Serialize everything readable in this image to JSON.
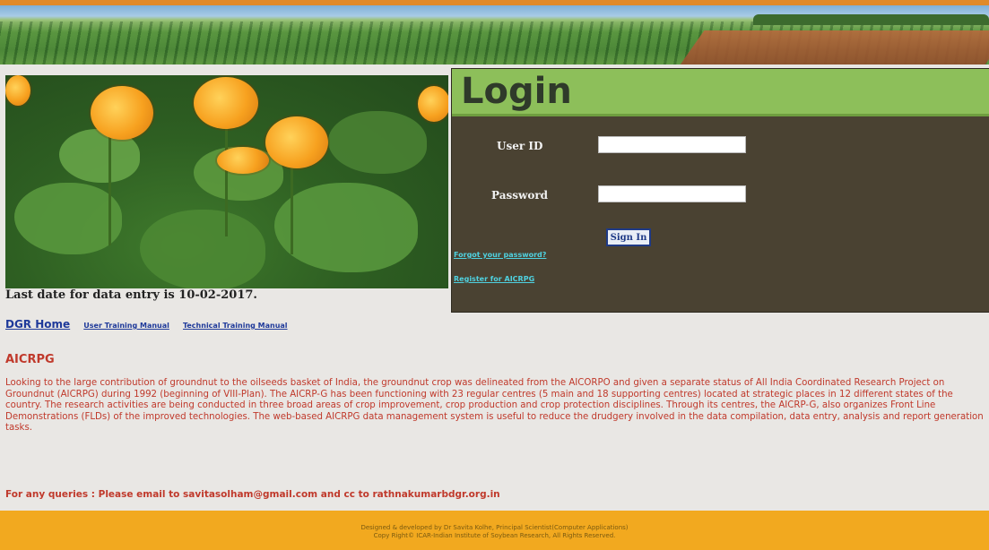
{
  "login": {
    "title": "Login",
    "user_id_label": "User ID",
    "user_id_value": "",
    "password_label": "Password",
    "password_value": "",
    "signin_label": "Sign In",
    "forgot_link": "Forgot your password?",
    "register_link": "Register for AICRPG"
  },
  "notice": {
    "last_date": "Last date for data entry is 10-02-2017."
  },
  "nav": {
    "home": "DGR Home",
    "user_manual": "User Training Manual",
    "technical_manual": "Technical Training Manual"
  },
  "section": {
    "title": "AICRPG",
    "description": "Looking to the large contribution of groundnut to the oilseeds basket of India, the groundnut crop was delineated from the AICORPO and given a separate status of All India Coordinated Research Project on Groundnut (AICRPG) during 1992 (beginning of VIII-Plan). The AICRP-G has been functioning with 23 regular centres (5 main and 18 supporting centres) located at strategic places in 12 different states of the country. The research activities are being conducted in three broad areas of crop improvement, crop production and crop protection disciplines. Through its centres, the AICRP-G, also organizes Front Line Demonstrations (FLDs) of the improved technologies. The web-based AICRPG data management system is useful to reduce the drudgery involved in the data compilation, data entry, analysis and report generation tasks.",
    "contact": "For any queries : Please email to savitasolham@gmail.com and cc to rathnakumarbdgr.org.in"
  },
  "footer": {
    "line1": "Designed & developed by Dr Savita Kolhe, Principal Scientist(Computer Applications)",
    "line2": "Copy Right© ICAR-Indian Institute of Soybean Research, All Rights Reserved."
  },
  "colors": {
    "login_header": "#8dbf5a",
    "login_panel": "#4a4232",
    "footer": "#f2a91f",
    "section_text": "#c0392b",
    "link": "#1f3a9a"
  }
}
